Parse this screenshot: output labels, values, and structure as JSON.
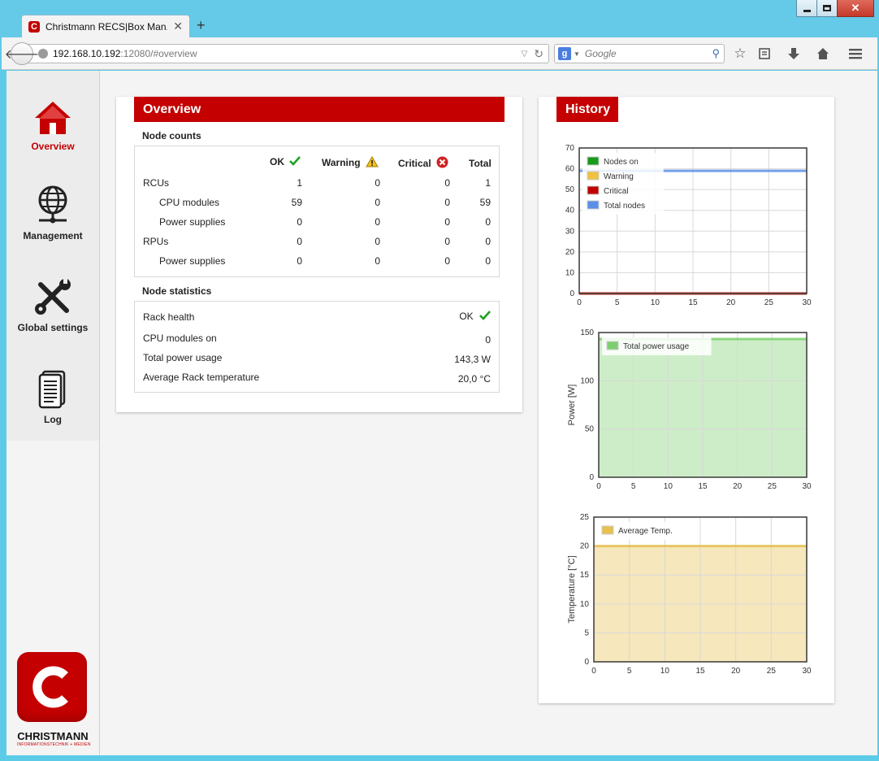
{
  "browser": {
    "tab_title": "Christmann RECS|Box Man...",
    "tab_favicon_letter": "C",
    "url_host": "192.168.10.192",
    "url_rest": ":12080/#overview",
    "search_engine_letter": "g",
    "search_placeholder": "Google"
  },
  "sidebar": {
    "items": [
      {
        "label": "Overview",
        "icon": "home-icon",
        "active": true
      },
      {
        "label": "Management",
        "icon": "network-globe-icon",
        "active": false
      },
      {
        "label": "Global settings",
        "icon": "tools-icon",
        "active": false
      },
      {
        "label": "Log",
        "icon": "document-icon",
        "active": false
      }
    ],
    "logo_letter": "C",
    "logo_text": "CHRISTMANN",
    "logo_subtext": "INFORMATIONSTECHNIK + MEDIEN"
  },
  "overview": {
    "title": "Overview",
    "node_counts_title": "Node counts",
    "columns": [
      "OK",
      "Warning",
      "Critical",
      "Total"
    ],
    "rows": [
      {
        "label": "RCUs",
        "indent": false,
        "values": [
          "1",
          "0",
          "0",
          "1"
        ]
      },
      {
        "label": "CPU modules",
        "indent": true,
        "values": [
          "59",
          "0",
          "0",
          "59"
        ]
      },
      {
        "label": "Power supplies",
        "indent": true,
        "values": [
          "0",
          "0",
          "0",
          "0"
        ]
      },
      {
        "label": "RPUs",
        "indent": false,
        "values": [
          "0",
          "0",
          "0",
          "0"
        ]
      },
      {
        "label": "Power supplies",
        "indent": true,
        "values": [
          "0",
          "0",
          "0",
          "0"
        ]
      }
    ],
    "node_stats_title": "Node statistics",
    "stats": [
      {
        "label": "Rack health",
        "value": "OK"
      },
      {
        "label": "CPU modules on",
        "value": "0"
      },
      {
        "label": "Total power usage",
        "value": "143,3 W"
      },
      {
        "label": "Average Rack temperature",
        "value": "20,0 °C"
      }
    ]
  },
  "history": {
    "title": "History"
  },
  "colors": {
    "brand_red": "#c40000",
    "ok_green": "#20a020",
    "warning_yellow": "#f0c020",
    "critical_red": "#d02020"
  },
  "chart_data": [
    {
      "type": "line",
      "x": [
        0,
        30
      ],
      "series": [
        {
          "name": "Nodes on",
          "values": [
            0,
            0
          ],
          "color": "#1a9a1a"
        },
        {
          "name": "Warning",
          "values": [
            0,
            0
          ],
          "color": "#f0c040"
        },
        {
          "name": "Critical",
          "values": [
            0,
            0
          ],
          "color": "#c00000"
        },
        {
          "name": "Total nodes",
          "values": [
            59,
            59
          ],
          "color": "#5b8fe8"
        }
      ],
      "ylim": [
        0,
        70
      ],
      "yticks": [
        0,
        10,
        20,
        30,
        40,
        50,
        60,
        70
      ],
      "xlim": [
        0,
        30
      ],
      "xticks": [
        0,
        5,
        10,
        15,
        20,
        25,
        30
      ],
      "ylabel": "",
      "legend": "top-left",
      "grid": true
    },
    {
      "type": "area",
      "x": [
        0,
        30
      ],
      "series": [
        {
          "name": "Total power usage",
          "values": [
            143.3,
            143.3
          ],
          "color": "#7ccf6e"
        }
      ],
      "ylim": [
        0,
        150
      ],
      "yticks": [
        0,
        50,
        100,
        150
      ],
      "xlim": [
        0,
        30
      ],
      "xticks": [
        0,
        5,
        10,
        15,
        20,
        25,
        30
      ],
      "ylabel": "Power [W]",
      "legend": "top-left",
      "grid": true
    },
    {
      "type": "area",
      "x": [
        0,
        30
      ],
      "series": [
        {
          "name": "Average Temp.",
          "values": [
            20.0,
            20.0
          ],
          "color": "#e8c050"
        }
      ],
      "ylim": [
        0,
        25
      ],
      "yticks": [
        0,
        5,
        10,
        15,
        20,
        25
      ],
      "xlim": [
        0,
        30
      ],
      "xticks": [
        0,
        5,
        10,
        15,
        20,
        25,
        30
      ],
      "ylabel": "Temperature [°C]",
      "legend": "top-left",
      "grid": true
    }
  ]
}
